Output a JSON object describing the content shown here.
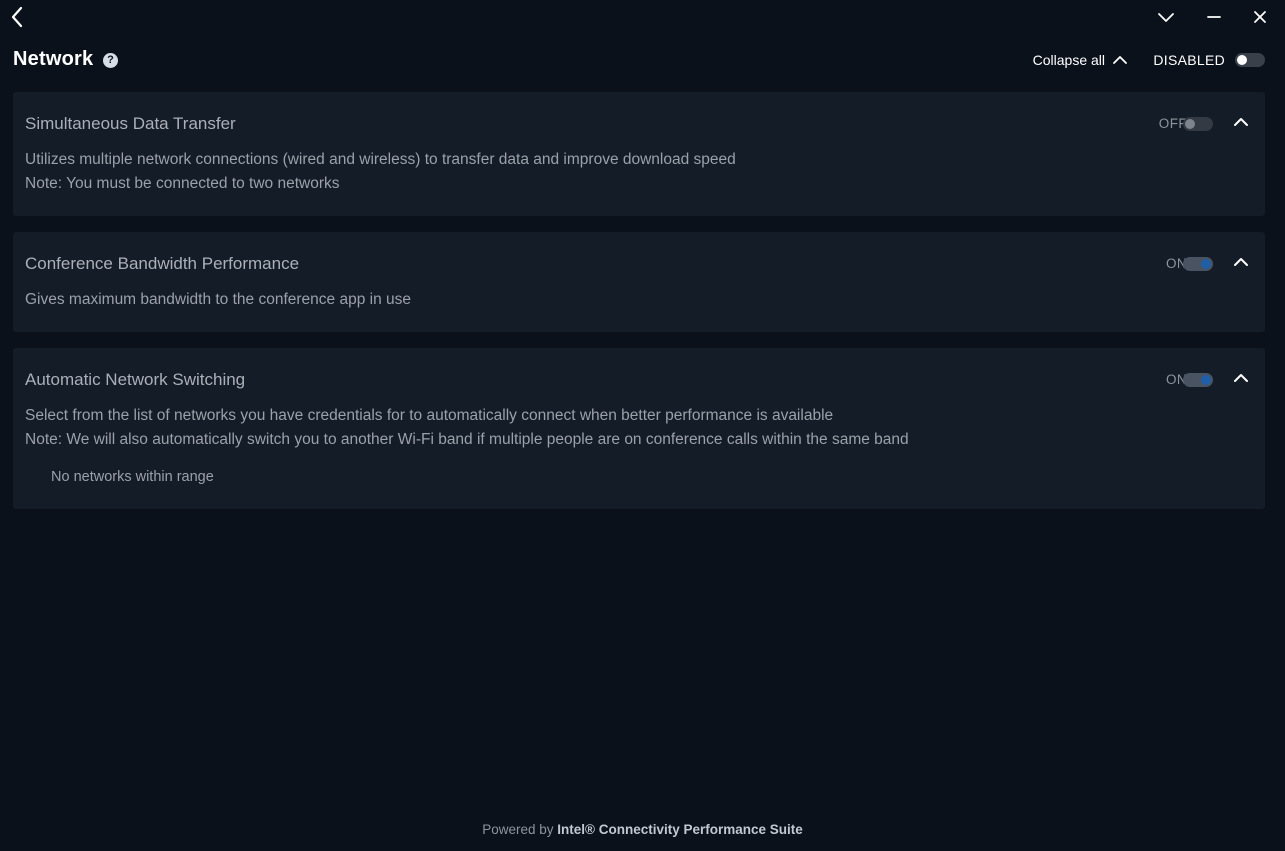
{
  "window": {
    "back_icon": "chevron-left-icon",
    "menu_icon": "chevron-down-icon",
    "minimize_icon": "minimize-icon",
    "close_icon": "close-icon"
  },
  "header": {
    "title": "Network",
    "help_glyph": "?",
    "collapse_all_label": "Collapse all",
    "master_state_label": "DISABLED",
    "master_enabled": false
  },
  "cards": [
    {
      "title": "Simultaneous Data Transfer",
      "state_label": "OFF",
      "enabled": false,
      "description": "Utilizes multiple network connections (wired and wireless) to transfer data and improve download speed",
      "note": "Note: You must be connected to two networks"
    },
    {
      "title": "Conference Bandwidth Performance",
      "state_label": "ON",
      "enabled": true,
      "description": "Gives maximum bandwidth to the conference app in use"
    },
    {
      "title": "Automatic Network Switching",
      "state_label": "ON",
      "enabled": true,
      "description": "Select from the list of networks you have credentials for to automatically connect when better performance is available",
      "note": "Note: We will also automatically switch you to another Wi-Fi band if multiple people are on conference calls within the same band",
      "empty_message": "No networks within range"
    }
  ],
  "footer": {
    "prefix": "Powered by",
    "brand": "Intel® Connectivity Performance Suite"
  },
  "colors": {
    "background": "#0b111b",
    "card": "#141c27",
    "toggle_on_knob": "#1f5fa8"
  }
}
